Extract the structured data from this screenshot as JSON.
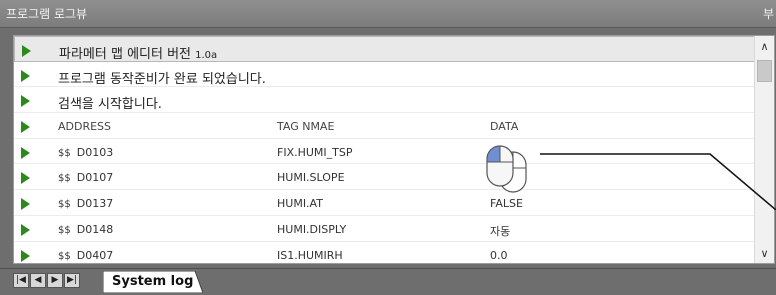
{
  "window": {
    "title": "프로그램 로그뷰",
    "right_glyph": "부"
  },
  "log": {
    "messages": [
      {
        "text": "파라메터 맵 에디터 버전",
        "version": "1.0a"
      },
      {
        "text": "프로그램 동작준비가 완료 되었습니다."
      },
      {
        "text": "검색을 시작합니다."
      }
    ],
    "columns": [
      "ADDRESS",
      "TAG NMAE",
      "DATA"
    ],
    "rows": [
      {
        "prefix": "$$",
        "address": "D0103",
        "tag": "FIX.HUMI_TSP",
        "data": ""
      },
      {
        "prefix": "$$",
        "address": "D0107",
        "tag": "HUMI.SLOPE",
        "data": ""
      },
      {
        "prefix": "$$",
        "address": "D0137",
        "tag": "HUMI.AT",
        "data": "FALSE"
      },
      {
        "prefix": "$$",
        "address": "D0148",
        "tag": "HUMI.DISPLY",
        "data": "자동"
      },
      {
        "prefix": "$$",
        "address": "D0407",
        "tag": "IS1.HUMIRH",
        "data": "0.0"
      }
    ]
  },
  "scrollbar": {
    "up_icon": "chevron-up-icon",
    "down_icon": "chevron-down-icon"
  },
  "tabs": {
    "nav_icons": [
      "first-icon",
      "prev-icon",
      "next-icon",
      "last-icon"
    ],
    "active_label": "System log"
  },
  "overlay": {
    "icon": "mouse-icon"
  },
  "colors": {
    "row_arrow": "#2c8a1d",
    "frame": "#6e6e6e",
    "highlight_row": "#e9e9e9"
  }
}
